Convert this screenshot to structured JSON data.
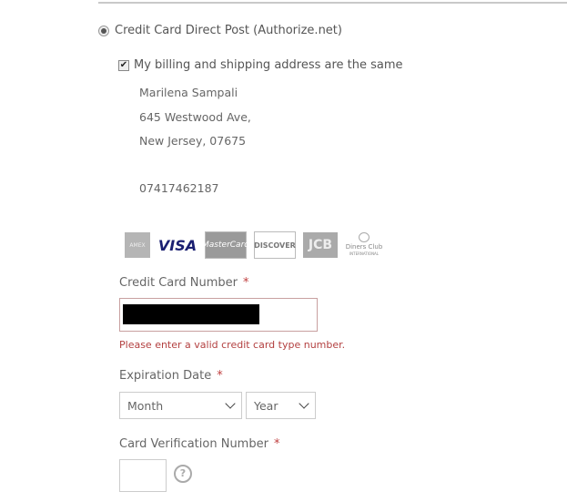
{
  "payment_method": {
    "label": "Credit Card Direct Post (Authorize.net)",
    "selected": true
  },
  "same_address": {
    "label": "My billing and shipping address are the same",
    "checked": true,
    "check_glyph": "✔"
  },
  "address": {
    "name": "Marilena Sampali",
    "street": "645 Westwood Ave,",
    "city_zip": "New Jersey, 07675",
    "phone": "07417462187"
  },
  "card_types": [
    {
      "name": "American Express",
      "text": "AMEX"
    },
    {
      "name": "Visa",
      "text": "VISA"
    },
    {
      "name": "MasterCard",
      "text": "MasterCard"
    },
    {
      "name": "Discover",
      "text": "DISCOVER"
    },
    {
      "name": "JCB",
      "text": "JCB"
    },
    {
      "name": "Diners Club",
      "text": "Diners Club",
      "subtext": "INTERNATIONAL"
    }
  ],
  "cc_number": {
    "label": "Credit Card Number",
    "required_mark": "*",
    "value_redacted": true,
    "error": "Please enter a valid credit card type number."
  },
  "expiration": {
    "label": "Expiration Date",
    "required_mark": "*",
    "month_value": "Month",
    "year_value": "Year"
  },
  "cvv": {
    "label": "Card Verification Number",
    "required_mark": "*",
    "value": "",
    "help_glyph": "?"
  },
  "colors": {
    "error": "#b34040",
    "required": "#c04040",
    "invalid_border": "#c8a0a0"
  }
}
